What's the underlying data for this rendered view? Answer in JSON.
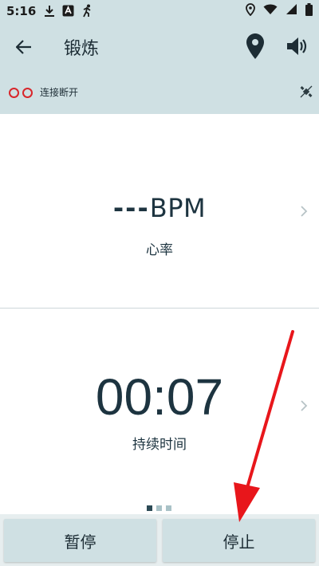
{
  "status_bar": {
    "time": "5:16",
    "icons_left": [
      "download-icon",
      "a-badge-icon",
      "running-icon"
    ],
    "icons_right": [
      "location-icon",
      "wifi-icon",
      "signal-icon",
      "battery-icon"
    ]
  },
  "app_bar": {
    "title": "锻炼",
    "back_icon": "arrow-back-icon",
    "location_icon": "location-pin-icon",
    "sound_icon": "volume-icon"
  },
  "connection": {
    "status": "连接断开",
    "color": "#d8262b",
    "sat_icon": "satellite-off-icon"
  },
  "heart_rate": {
    "value": "---",
    "unit": "BPM",
    "label": "心率"
  },
  "duration": {
    "value": "00:07",
    "label": "持续时间"
  },
  "pager": {
    "count": 3,
    "active": 0
  },
  "actions": {
    "pause": "暂停",
    "stop": "停止"
  },
  "colors": {
    "bar_background": "#cfe0e3",
    "text": "#1d3440",
    "arrow": "#e8161b"
  }
}
